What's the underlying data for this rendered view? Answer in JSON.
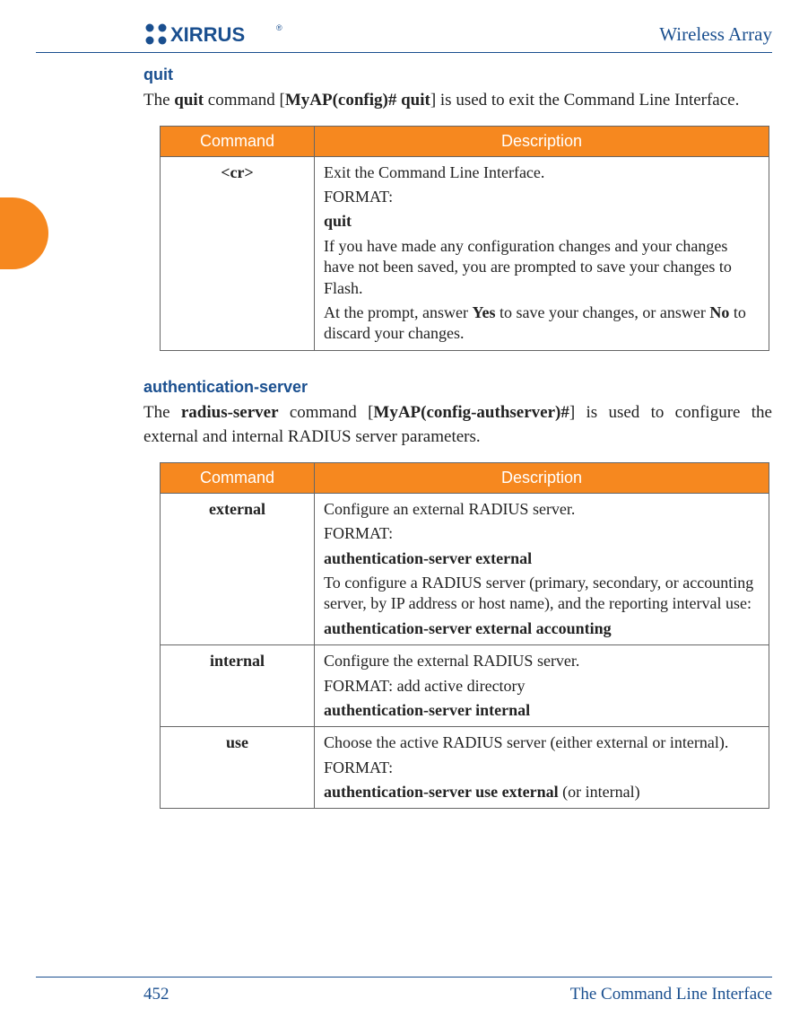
{
  "header": {
    "product": "Wireless Array",
    "logo_main": "XIRRUS",
    "logo_mark": "®"
  },
  "sections": [
    {
      "heading": "quit",
      "intro_pre": "The ",
      "intro_bold1": "quit",
      "intro_mid1": " command [",
      "intro_bold2": "MyAP(config)# quit",
      "intro_mid2": "] is used to exit the Command Line Interface.",
      "table": {
        "col1": "Command",
        "col2": "Description",
        "rows": [
          {
            "cmd": "<cr>",
            "lines": [
              {
                "text": "Exit the Command Line Interface."
              },
              {
                "text": "FORMAT:"
              },
              {
                "bold": "quit"
              },
              {
                "text": "If you have made any configuration changes and your changes have not been saved, you are prompted to save your changes to Flash."
              },
              {
                "mixed_pre": "At the prompt, answer ",
                "b1": "Yes",
                "mid": " to save your changes, or answer ",
                "b2": "No",
                "post": " to discard your changes."
              }
            ]
          }
        ]
      }
    },
    {
      "heading": "authentication-server",
      "intro_pre": "The ",
      "intro_bold1": "radius-server",
      "intro_mid1": " command [",
      "intro_bold2": "MyAP(config-authserver)#",
      "intro_mid2": "] is used to configure the external and internal RADIUS server parameters.",
      "table": {
        "col1": "Command",
        "col2": "Description",
        "rows": [
          {
            "cmd": "external",
            "lines": [
              {
                "text": "Configure an external RADIUS server."
              },
              {
                "text": "FORMAT:"
              },
              {
                "bold": "authentication-server external"
              },
              {
                "text": "To configure a RADIUS server (primary, secondary, or accounting server, by IP address or host name), and the reporting interval use:"
              },
              {
                "bold": "authentication-server external accounting"
              }
            ]
          },
          {
            "cmd": "internal",
            "lines": [
              {
                "text": "Configure the external RADIUS server."
              },
              {
                "text": "FORMAT: add active directory"
              },
              {
                "bold": "authentication-server internal"
              }
            ]
          },
          {
            "cmd": "use",
            "lines": [
              {
                "text": "Choose the active RADIUS server (either external or internal)."
              },
              {
                "text": "FORMAT:"
              },
              {
                "bold_pre": "authentication-server use external",
                "post": " (or internal)"
              }
            ]
          }
        ]
      }
    }
  ],
  "footer": {
    "page": "452",
    "title": "The Command Line Interface"
  }
}
